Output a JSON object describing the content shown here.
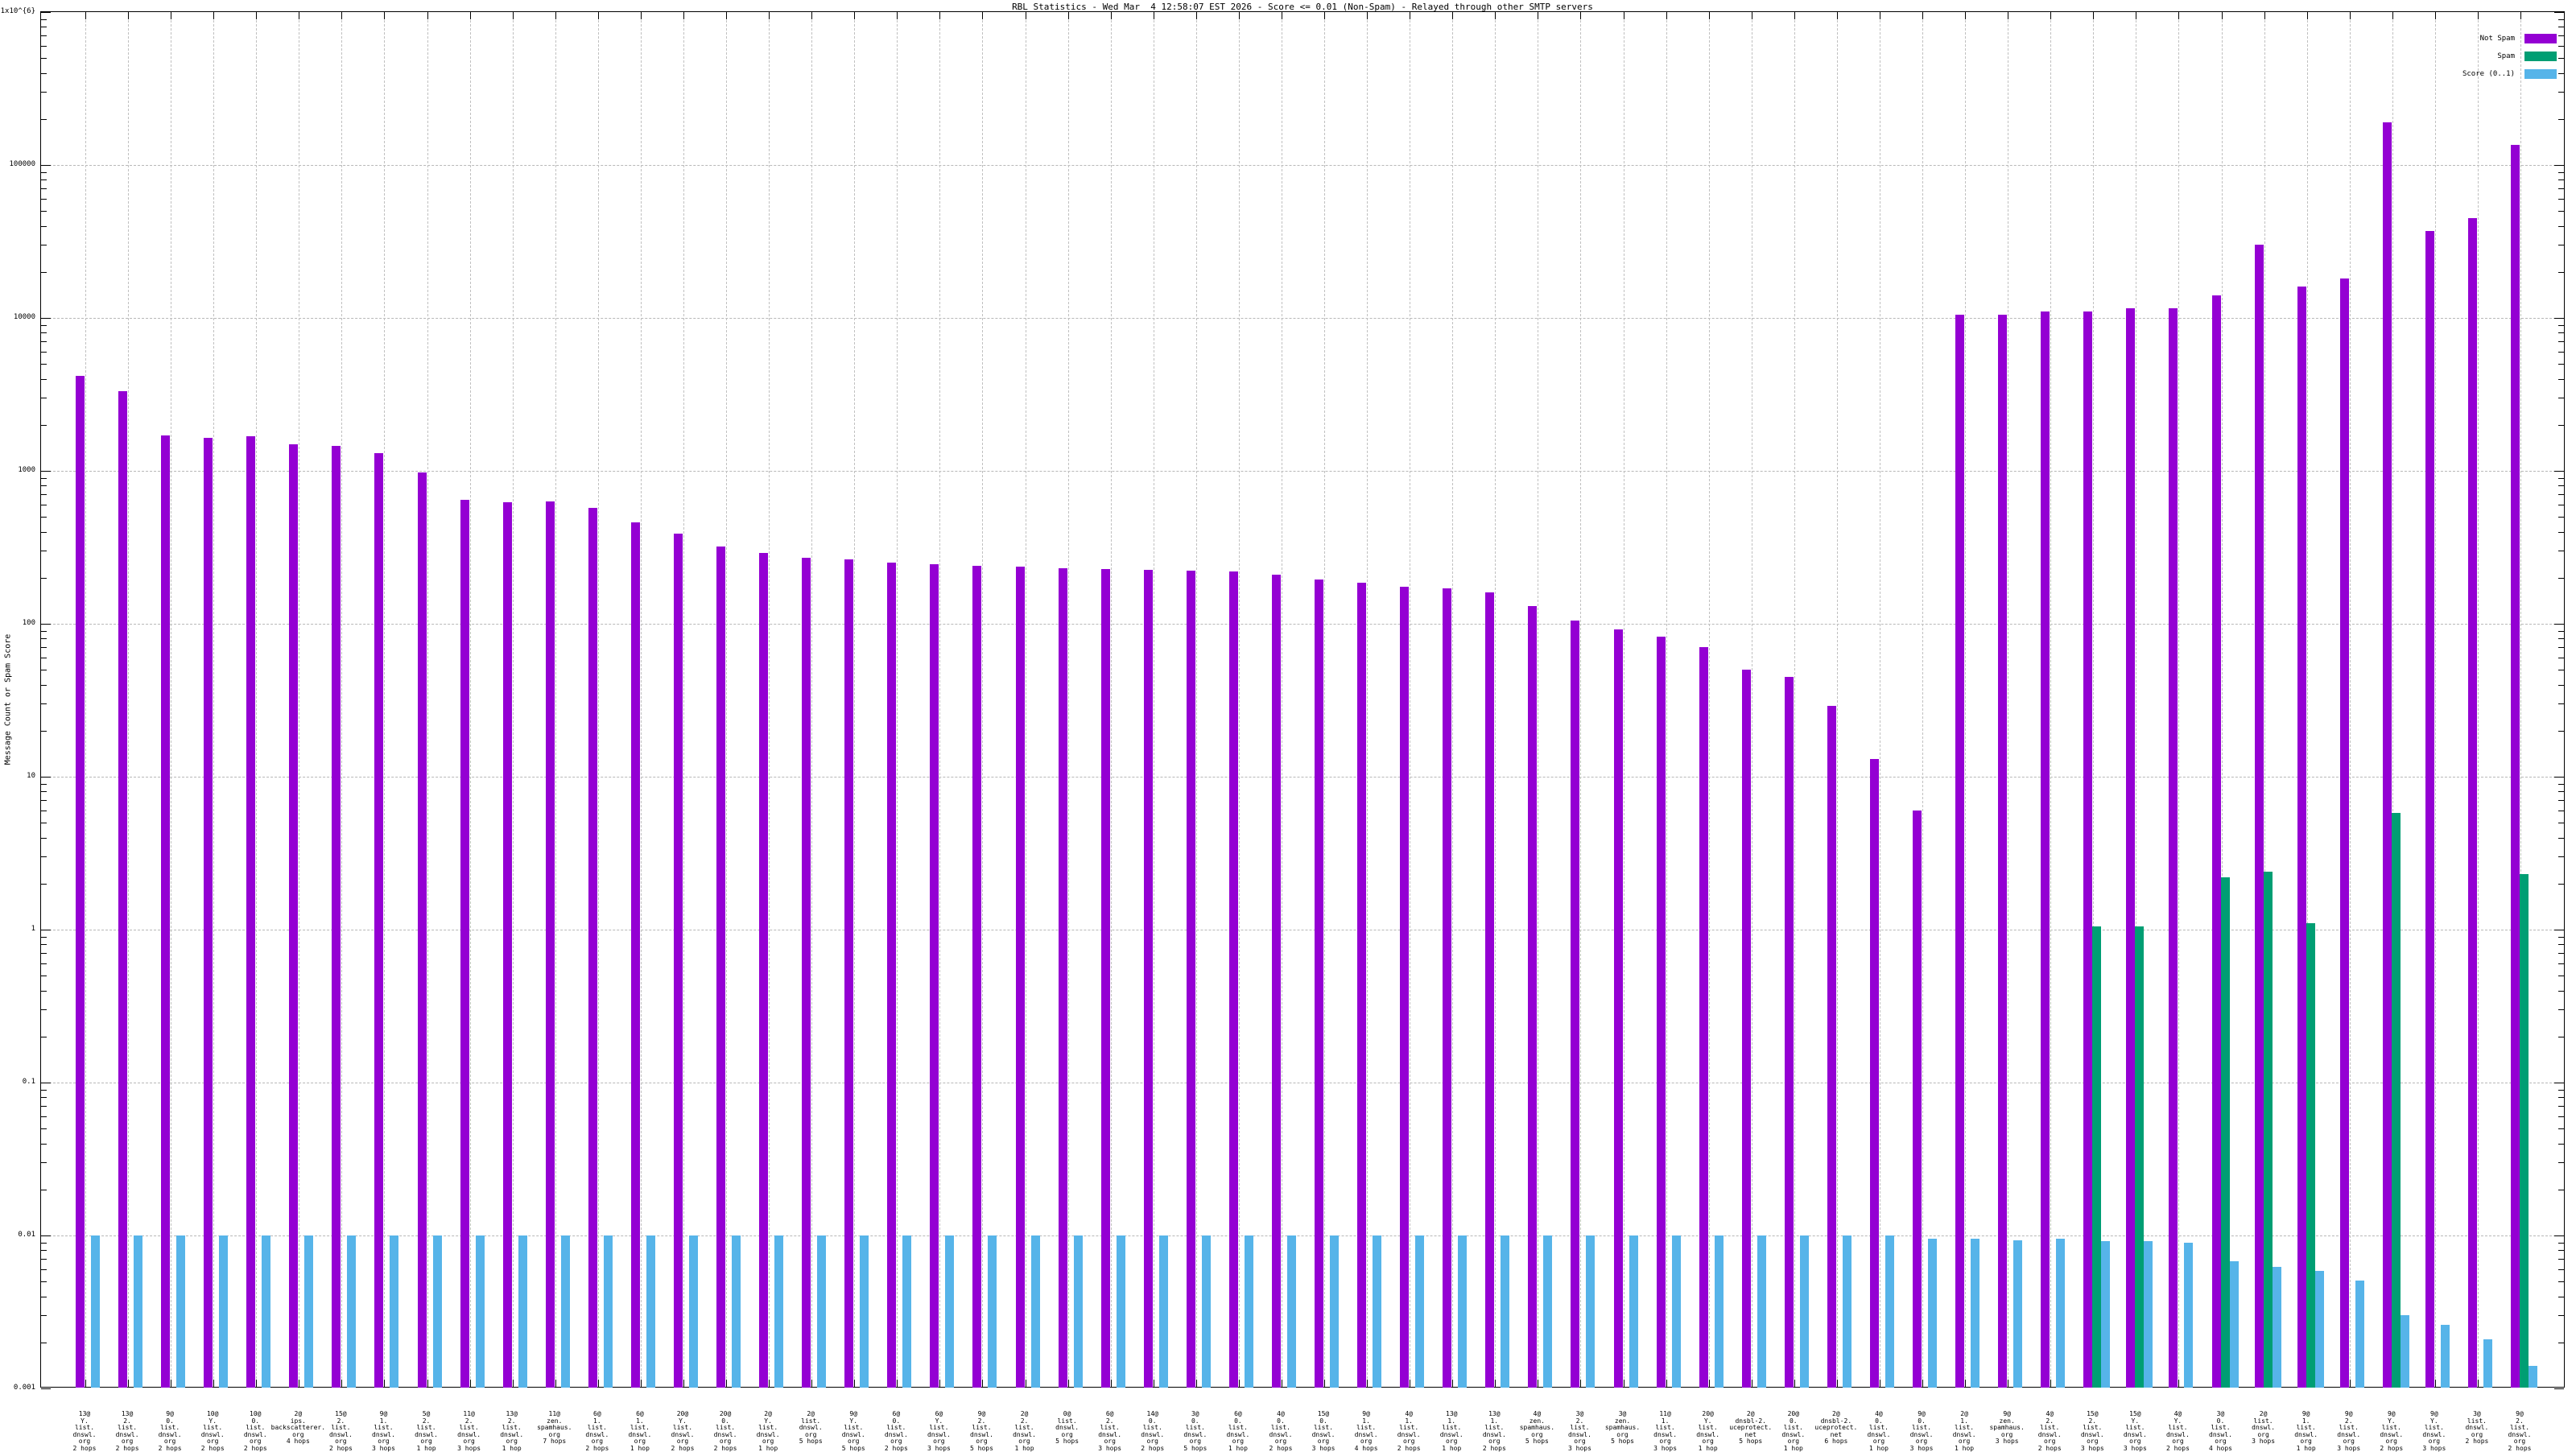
{
  "title": "RBL Statistics - Wed Mar  4 12:58:07 EST 2026 - Score <= 0.01 (Non-Spam) - Relayed through other SMTP servers",
  "y_axis": {
    "label": "Message Count or Spam Score",
    "ticks": [
      {
        "text": "1x10^{6}",
        "value": 1000000
      },
      {
        "text": "100000",
        "value": 100000
      },
      {
        "text": "10000",
        "value": 10000
      },
      {
        "text": "1000",
        "value": 1000
      },
      {
        "text": "100",
        "value": 100
      },
      {
        "text": "10",
        "value": 10
      },
      {
        "text": "1",
        "value": 1
      },
      {
        "text": "0.1",
        "value": 0.1
      },
      {
        "text": "0.01",
        "value": 0.01
      },
      {
        "text": "0.001",
        "value": 0.001
      }
    ]
  },
  "legend": {
    "entries": [
      {
        "label": "Not Spam",
        "color": "#9400d3"
      },
      {
        "label": "Spam",
        "color": "#009e73"
      },
      {
        "label": "Score (0..1)",
        "color": "#56b4e9"
      }
    ]
  },
  "colors": {
    "not_spam": "#9400d3",
    "spam": "#009e73",
    "score": "#56b4e9",
    "grid": "#b8b8b8"
  },
  "chart_data": {
    "type": "bar",
    "title": "RBL Statistics - Wed Mar  4 12:58:07 EST 2026 - Score <= 0.01 (Non-Spam) - Relayed through other SMTP servers",
    "ylabel": "Message Count or Spam Score",
    "y_scale": "log",
    "ylim": [
      0.001,
      1000000
    ],
    "grid": true,
    "legend_position": "top-right",
    "series_names": [
      "Not Spam",
      "Spam",
      "Score (0..1)"
    ],
    "groups": [
      {
        "label_lines": [
          "13@",
          "Y.",
          "list.",
          "dnswl.",
          "org",
          "2 hops"
        ],
        "not_spam": 4200,
        "spam": null,
        "score": 0.01
      },
      {
        "label_lines": [
          "13@",
          "2.",
          "list.",
          "dnswl.",
          "org",
          "2 hops"
        ],
        "not_spam": 3300,
        "spam": null,
        "score": 0.01
      },
      {
        "label_lines": [
          "9@",
          "0.",
          "list.",
          "dnswl.",
          "org",
          "2 hops"
        ],
        "not_spam": 1700,
        "spam": null,
        "score": 0.01
      },
      {
        "label_lines": [
          "10@",
          "Y.",
          "list.",
          "dnswl.",
          "org",
          "2 hops"
        ],
        "not_spam": 1650,
        "spam": null,
        "score": 0.01
      },
      {
        "label_lines": [
          "10@",
          "0.",
          "list.",
          "dnswl.",
          "org",
          "2 hops"
        ],
        "not_spam": 1680,
        "spam": null,
        "score": 0.01
      },
      {
        "label_lines": [
          "2@",
          "ips.",
          "backscatterer.",
          "org",
          "4 hops"
        ],
        "not_spam": 1500,
        "spam": null,
        "score": 0.01
      },
      {
        "label_lines": [
          "15@",
          "2.",
          "list.",
          "dnswl.",
          "org",
          "2 hops"
        ],
        "not_spam": 1450,
        "spam": null,
        "score": 0.01
      },
      {
        "label_lines": [
          "9@",
          "1.",
          "list.",
          "dnswl.",
          "org",
          "3 hops"
        ],
        "not_spam": 1300,
        "spam": null,
        "score": 0.01
      },
      {
        "label_lines": [
          "5@",
          "2.",
          "list.",
          "dnswl.",
          "org",
          "1 hop"
        ],
        "not_spam": 980,
        "spam": null,
        "score": 0.01
      },
      {
        "label_lines": [
          "11@",
          "2.",
          "list.",
          "dnswl.",
          "org",
          "3 hops"
        ],
        "not_spam": 650,
        "spam": null,
        "score": 0.01
      },
      {
        "label_lines": [
          "13@",
          "2.",
          "list.",
          "dnswl.",
          "org",
          "1 hop"
        ],
        "not_spam": 620,
        "spam": null,
        "score": 0.01
      },
      {
        "label_lines": [
          "11@",
          "zen.",
          "spamhaus.",
          "org",
          "7 hops"
        ],
        "not_spam": 630,
        "spam": null,
        "score": 0.01
      },
      {
        "label_lines": [
          "6@",
          "1.",
          "list.",
          "dnswl.",
          "org",
          "2 hops"
        ],
        "not_spam": 570,
        "spam": null,
        "score": 0.01
      },
      {
        "label_lines": [
          "6@",
          "1.",
          "list.",
          "dnswl.",
          "org",
          "1 hop"
        ],
        "not_spam": 460,
        "spam": null,
        "score": 0.01
      },
      {
        "label_lines": [
          "20@",
          "Y.",
          "list.",
          "dnswl.",
          "org",
          "2 hops"
        ],
        "not_spam": 390,
        "spam": null,
        "score": 0.01
      },
      {
        "label_lines": [
          "20@",
          "0.",
          "list.",
          "dnswl.",
          "org",
          "2 hops"
        ],
        "not_spam": 320,
        "spam": null,
        "score": 0.01
      },
      {
        "label_lines": [
          "2@",
          "Y.",
          "list.",
          "dnswl.",
          "org",
          "1 hop"
        ],
        "not_spam": 290,
        "spam": null,
        "score": 0.01
      },
      {
        "label_lines": [
          "2@",
          "list.",
          "dnswl.",
          "org",
          "5 hops"
        ],
        "not_spam": 270,
        "spam": null,
        "score": 0.01
      },
      {
        "label_lines": [
          "9@",
          "Y.",
          "list.",
          "dnswl.",
          "org",
          "5 hops"
        ],
        "not_spam": 265,
        "spam": null,
        "score": 0.01
      },
      {
        "label_lines": [
          "6@",
          "0.",
          "list.",
          "dnswl.",
          "org",
          "2 hops"
        ],
        "not_spam": 250,
        "spam": null,
        "score": 0.01
      },
      {
        "label_lines": [
          "6@",
          "Y.",
          "list.",
          "dnswl.",
          "org",
          "3 hops"
        ],
        "not_spam": 245,
        "spam": null,
        "score": 0.01
      },
      {
        "label_lines": [
          "9@",
          "2.",
          "list.",
          "dnswl.",
          "org",
          "5 hops"
        ],
        "not_spam": 240,
        "spam": null,
        "score": 0.01
      },
      {
        "label_lines": [
          "2@",
          "2.",
          "list.",
          "dnswl.",
          "org",
          "1 hop"
        ],
        "not_spam": 235,
        "spam": null,
        "score": 0.01
      },
      {
        "label_lines": [
          "0@",
          "list.",
          "dnswl.",
          "org",
          "5 hops"
        ],
        "not_spam": 230,
        "spam": null,
        "score": 0.01
      },
      {
        "label_lines": [
          "6@",
          "2.",
          "list.",
          "dnswl.",
          "org",
          "3 hops"
        ],
        "not_spam": 228,
        "spam": null,
        "score": 0.01
      },
      {
        "label_lines": [
          "14@",
          "0.",
          "list.",
          "dnswl.",
          "org",
          "2 hops"
        ],
        "not_spam": 225,
        "spam": null,
        "score": 0.01
      },
      {
        "label_lines": [
          "3@",
          "0.",
          "list.",
          "dnswl.",
          "org",
          "5 hops"
        ],
        "not_spam": 222,
        "spam": null,
        "score": 0.01
      },
      {
        "label_lines": [
          "6@",
          "0.",
          "list.",
          "dnswl.",
          "org",
          "1 hop"
        ],
        "not_spam": 220,
        "spam": null,
        "score": 0.01
      },
      {
        "label_lines": [
          "4@",
          "0.",
          "list.",
          "dnswl.",
          "org",
          "2 hops"
        ],
        "not_spam": 210,
        "spam": null,
        "score": 0.01
      },
      {
        "label_lines": [
          "15@",
          "0.",
          "list.",
          "dnswl.",
          "org",
          "3 hops"
        ],
        "not_spam": 195,
        "spam": null,
        "score": 0.01
      },
      {
        "label_lines": [
          "9@",
          "1.",
          "list.",
          "dnswl.",
          "org",
          "4 hops"
        ],
        "not_spam": 185,
        "spam": null,
        "score": 0.01
      },
      {
        "label_lines": [
          "4@",
          "1.",
          "list.",
          "dnswl.",
          "org",
          "2 hops"
        ],
        "not_spam": 175,
        "spam": null,
        "score": 0.01
      },
      {
        "label_lines": [
          "13@",
          "1.",
          "list.",
          "dnswl.",
          "org",
          "1 hop"
        ],
        "not_spam": 170,
        "spam": null,
        "score": 0.01
      },
      {
        "label_lines": [
          "13@",
          "1.",
          "list.",
          "dnswl.",
          "org",
          "2 hops"
        ],
        "not_spam": 160,
        "spam": null,
        "score": 0.01
      },
      {
        "label_lines": [
          "4@",
          "zen.",
          "spamhaus.",
          "org",
          "5 hops"
        ],
        "not_spam": 130,
        "spam": null,
        "score": 0.01
      },
      {
        "label_lines": [
          "3@",
          "2.",
          "list.",
          "dnswl.",
          "org",
          "3 hops"
        ],
        "not_spam": 105,
        "spam": null,
        "score": 0.01
      },
      {
        "label_lines": [
          "3@",
          "zen.",
          "spamhaus.",
          "org",
          "5 hops"
        ],
        "not_spam": 92,
        "spam": null,
        "score": 0.01
      },
      {
        "label_lines": [
          "11@",
          "1.",
          "list.",
          "dnswl.",
          "org",
          "3 hops"
        ],
        "not_spam": 82,
        "spam": null,
        "score": 0.01
      },
      {
        "label_lines": [
          "20@",
          "Y.",
          "list.",
          "dnswl.",
          "org",
          "1 hop"
        ],
        "not_spam": 70,
        "spam": null,
        "score": 0.01
      },
      {
        "label_lines": [
          "2@",
          "dnsbl-2.",
          "uceprotect.",
          "net",
          "5 hops"
        ],
        "not_spam": 50,
        "spam": null,
        "score": 0.01
      },
      {
        "label_lines": [
          "20@",
          "0.",
          "list.",
          "dnswl.",
          "org",
          "1 hop"
        ],
        "not_spam": 45,
        "spam": null,
        "score": 0.01
      },
      {
        "label_lines": [
          "2@",
          "dnsbl-2.",
          "uceprotect.",
          "net",
          "6 hops"
        ],
        "not_spam": 29,
        "spam": null,
        "score": 0.01
      },
      {
        "label_lines": [
          "4@",
          "0.",
          "list.",
          "dnswl.",
          "org",
          "1 hop"
        ],
        "not_spam": 13,
        "spam": null,
        "score": 0.01
      },
      {
        "label_lines": [
          "9@",
          "0.",
          "list.",
          "dnswl.",
          "org",
          "3 hops"
        ],
        "not_spam": 6,
        "spam": null,
        "score": 0.0095
      },
      {
        "label_lines": [
          "2@",
          "1.",
          "list.",
          "dnswl.",
          "org",
          "1 hop"
        ],
        "not_spam": 10500,
        "spam": null,
        "score": 0.0095
      },
      {
        "label_lines": [
          "9@",
          "zen.",
          "spamhaus.",
          "org",
          "3 hops"
        ],
        "not_spam": 10500,
        "spam": null,
        "score": 0.0093
      },
      {
        "label_lines": [
          "4@",
          "2.",
          "list.",
          "dnswl.",
          "org",
          "2 hops"
        ],
        "not_spam": 11000,
        "spam": null,
        "score": 0.0095
      },
      {
        "label_lines": [
          "15@",
          "2.",
          "list.",
          "dnswl.",
          "org",
          "3 hops"
        ],
        "not_spam": 11000,
        "spam": 1.05,
        "score": 0.0092
      },
      {
        "label_lines": [
          "15@",
          "Y.",
          "list.",
          "dnswl.",
          "org",
          "3 hops"
        ],
        "not_spam": 11500,
        "spam": 1.05,
        "score": 0.0092
      },
      {
        "label_lines": [
          "4@",
          "Y.",
          "list.",
          "dnswl.",
          "org",
          "2 hops"
        ],
        "not_spam": 11500,
        "spam": null,
        "score": 0.009
      },
      {
        "label_lines": [
          "3@",
          "0.",
          "list.",
          "dnswl.",
          "org",
          "4 hops"
        ],
        "not_spam": 14000,
        "spam": 2.2,
        "score": 0.0068
      },
      {
        "label_lines": [
          "2@",
          "list.",
          "dnswl.",
          "org",
          "3 hops"
        ],
        "not_spam": 30000,
        "spam": 2.4,
        "score": 0.0062
      },
      {
        "label_lines": [
          "9@",
          "1.",
          "list.",
          "dnswl.",
          "org",
          "1 hop"
        ],
        "not_spam": 16000,
        "spam": 1.1,
        "score": 0.0059
      },
      {
        "label_lines": [
          "9@",
          "2.",
          "list.",
          "dnswl.",
          "org",
          "3 hops"
        ],
        "not_spam": 18000,
        "spam": null,
        "score": 0.0051
      },
      {
        "label_lines": [
          "9@",
          "Y.",
          "list.",
          "dnswl.",
          "org",
          "2 hops"
        ],
        "not_spam": 190000,
        "spam": 5.8,
        "score": 0.003
      },
      {
        "label_lines": [
          "9@",
          "Y.",
          "list.",
          "dnswl.",
          "org",
          "3 hops"
        ],
        "not_spam": 37000,
        "spam": null,
        "score": 0.0026
      },
      {
        "label_lines": [
          "3@",
          "list.",
          "dnswl.",
          "org",
          "2 hops"
        ],
        "not_spam": 45000,
        "spam": null,
        "score": 0.0021
      },
      {
        "label_lines": [
          "9@",
          "2.",
          "list.",
          "dnswl.",
          "org",
          "2 hops"
        ],
        "not_spam": 135000,
        "spam": 2.3,
        "score": 0.0014
      }
    ]
  }
}
